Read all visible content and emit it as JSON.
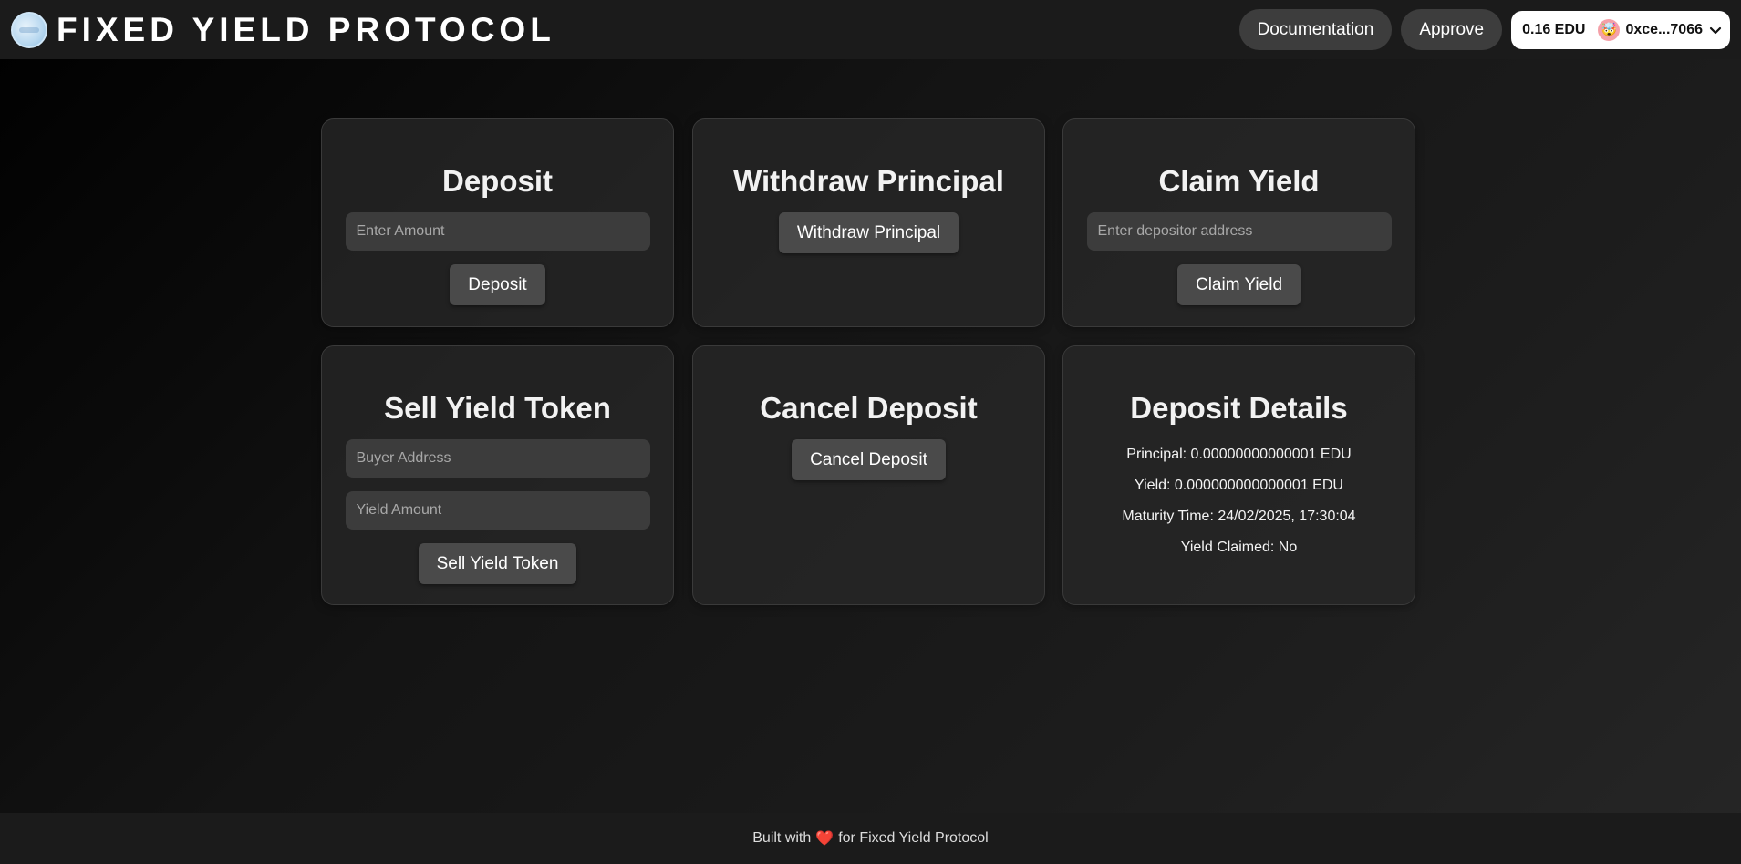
{
  "header": {
    "title": "FIXED YIELD PROTOCOL",
    "documentation_label": "Documentation",
    "approve_label": "Approve",
    "wallet": {
      "balance": "0.16 EDU",
      "account": "0xce...7066",
      "avatar_emoji": "🤯"
    }
  },
  "cards": {
    "deposit": {
      "title": "Deposit",
      "amount_placeholder": "Enter Amount",
      "button_label": "Deposit"
    },
    "withdraw": {
      "title": "Withdraw Principal",
      "button_label": "Withdraw Principal"
    },
    "claim": {
      "title": "Claim Yield",
      "address_placeholder": "Enter depositor address",
      "button_label": "Claim Yield"
    },
    "sell": {
      "title": "Sell Yield Token",
      "buyer_placeholder": "Buyer Address",
      "amount_placeholder": "Yield Amount",
      "button_label": "Sell Yield Token"
    },
    "cancel": {
      "title": "Cancel Deposit",
      "button_label": "Cancel Deposit"
    },
    "details": {
      "title": "Deposit Details",
      "principal": "Principal: 0.00000000000001 EDU",
      "yield": "Yield: 0.000000000000001 EDU",
      "maturity": "Maturity Time: 24/02/2025, 17:30:04",
      "claimed": "Yield Claimed: No"
    }
  },
  "footer": {
    "prefix": "Built with",
    "heart": "❤️",
    "suffix": "for Fixed Yield Protocol"
  },
  "colors": {
    "header_bg": "#1b1b1b",
    "card_bg": "#282828",
    "button_bg": "#4a4a4a",
    "input_bg": "#3c3c3c"
  }
}
